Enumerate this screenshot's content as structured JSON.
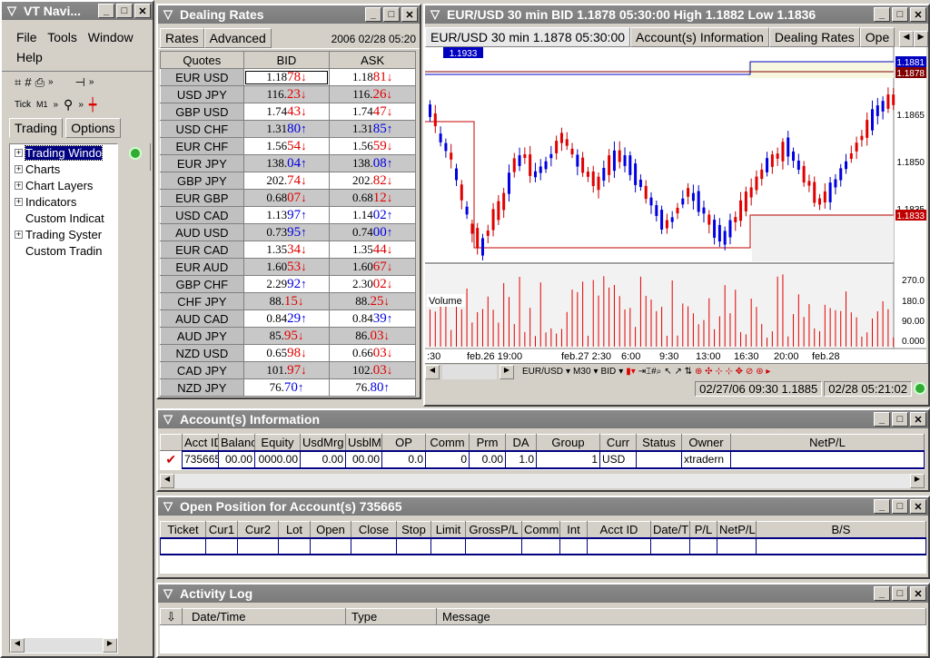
{
  "navigator": {
    "title": "VT Navi...",
    "menu": [
      "File",
      "Tools",
      "Window",
      "Help"
    ],
    "tick_label": "Tick",
    "timeframe": "M1",
    "tabs": [
      "Trading",
      "Options"
    ],
    "tree": [
      {
        "label": "Trading Windo",
        "expand": "+",
        "selected": true
      },
      {
        "label": "Charts",
        "expand": "+"
      },
      {
        "label": "Chart Layers",
        "expand": "+"
      },
      {
        "label": "Indicators",
        "expand": "+"
      },
      {
        "label": "Custom Indicat",
        "expand": ""
      },
      {
        "label": "Trading Syster",
        "expand": "+"
      },
      {
        "label": "Custom Tradin",
        "expand": ""
      }
    ]
  },
  "dealing": {
    "title": "Dealing Rates",
    "tabs": [
      "Rates",
      "Advanced"
    ],
    "datetime": "2006 02/28 05:20",
    "col_quotes": "Quotes",
    "col_bid": "BID",
    "col_ask": "ASK",
    "rows": [
      {
        "pair": "EUR USD",
        "bid_a": "1.18",
        "bid_b": "78",
        "bid_dir": "dn",
        "ask_a": "1.18",
        "ask_b": "81",
        "ask_dir": "dn"
      },
      {
        "pair": "USD JPY",
        "bid_a": "116.",
        "bid_b": "23",
        "bid_dir": "dn",
        "ask_a": "116.",
        "ask_b": "26",
        "ask_dir": "dn"
      },
      {
        "pair": "GBP USD",
        "bid_a": "1.74",
        "bid_b": "43",
        "bid_dir": "dn",
        "ask_a": "1.74",
        "ask_b": "47",
        "ask_dir": "dn"
      },
      {
        "pair": "USD CHF",
        "bid_a": "1.31",
        "bid_b": "80",
        "bid_dir": "up",
        "ask_a": "1.31",
        "ask_b": "85",
        "ask_dir": "up"
      },
      {
        "pair": "EUR CHF",
        "bid_a": "1.56",
        "bid_b": "54",
        "bid_dir": "dn",
        "ask_a": "1.56",
        "ask_b": "59",
        "ask_dir": "dn"
      },
      {
        "pair": "EUR JPY",
        "bid_a": "138.",
        "bid_b": "04",
        "bid_dir": "up",
        "ask_a": "138.",
        "ask_b": "08",
        "ask_dir": "up"
      },
      {
        "pair": "GBP JPY",
        "bid_a": "202.",
        "bid_b": "74",
        "bid_dir": "dn",
        "ask_a": "202.",
        "ask_b": "82",
        "ask_dir": "dn"
      },
      {
        "pair": "EUR GBP",
        "bid_a": "0.68",
        "bid_b": "07",
        "bid_dir": "dn",
        "ask_a": "0.68",
        "ask_b": "12",
        "ask_dir": "dn"
      },
      {
        "pair": "USD CAD",
        "bid_a": "1.13",
        "bid_b": "97",
        "bid_dir": "up",
        "ask_a": "1.14",
        "ask_b": "02",
        "ask_dir": "up"
      },
      {
        "pair": "AUD USD",
        "bid_a": "0.73",
        "bid_b": "95",
        "bid_dir": "up",
        "ask_a": "0.74",
        "ask_b": "00",
        "ask_dir": "up"
      },
      {
        "pair": "EUR CAD",
        "bid_a": "1.35",
        "bid_b": "34",
        "bid_dir": "dn",
        "ask_a": "1.35",
        "ask_b": "44",
        "ask_dir": "dn"
      },
      {
        "pair": "EUR AUD",
        "bid_a": "1.60",
        "bid_b": "53",
        "bid_dir": "dn",
        "ask_a": "1.60",
        "ask_b": "67",
        "ask_dir": "dn"
      },
      {
        "pair": "GBP CHF",
        "bid_a": "2.29",
        "bid_b": "92",
        "bid_dir": "up",
        "ask_a": "2.30",
        "ask_b": "02",
        "ask_dir": "dn"
      },
      {
        "pair": "CHF JPY",
        "bid_a": "88.",
        "bid_b": "15",
        "bid_dir": "dn",
        "ask_a": "88.",
        "ask_b": "25",
        "ask_dir": "dn"
      },
      {
        "pair": "AUD CAD",
        "bid_a": "0.84",
        "bid_b": "29",
        "bid_dir": "up",
        "ask_a": "0.84",
        "ask_b": "39",
        "ask_dir": "up"
      },
      {
        "pair": "AUD JPY",
        "bid_a": "85.",
        "bid_b": "95",
        "bid_dir": "dn",
        "ask_a": "86.",
        "ask_b": "03",
        "ask_dir": "dn"
      },
      {
        "pair": "NZD USD",
        "bid_a": "0.65",
        "bid_b": "98",
        "bid_dir": "dn",
        "ask_a": "0.66",
        "ask_b": "03",
        "ask_dir": "dn"
      },
      {
        "pair": "CAD JPY",
        "bid_a": "101.",
        "bid_b": "97",
        "bid_dir": "dn",
        "ask_a": "102.",
        "ask_b": "03",
        "ask_dir": "dn"
      },
      {
        "pair": "NZD JPY",
        "bid_a": "76.",
        "bid_b": "70",
        "bid_dir": "up",
        "ask_a": "76.",
        "ask_b": "80",
        "ask_dir": "up"
      }
    ]
  },
  "chartwin": {
    "title": "EUR/USD 30 min BID 1.1878 05:30:00 High 1.1882 Low 1.1836",
    "tabs": [
      "EUR/USD 30 min 1.1878 05:30:00",
      "Account(s) Information",
      "Dealing Rates",
      "Ope"
    ],
    "marker_label": "1.1933",
    "price_ticks": [
      "1.1865",
      "1.1850",
      "1.1835"
    ],
    "price_labels": {
      "top1": "1.1881",
      "top2": "1.1878",
      "low": "1.1833"
    },
    "volume_label": "Volume",
    "volume_ticks": [
      "270.0",
      "180.0",
      "90.00",
      "0.000"
    ],
    "time_ticks": [
      ":30",
      "feb.26 19:00",
      "feb.27 2:30",
      "6:00",
      "9:30",
      "13:00",
      "16:30",
      "20:00",
      "feb.28"
    ],
    "toolbar": {
      "symbol": "EUR/USD",
      "period": "M30",
      "side": "BID"
    },
    "status_left": "02/27/06 09:30  1.1885",
    "status_right": "02/28 05:21:02"
  },
  "account": {
    "title": "Account(s) Information",
    "columns": [
      "Acct ID",
      "Balanc",
      "Equity",
      "UsdMrg",
      "UsblM",
      "OP",
      "Comm",
      "Prm",
      "DA",
      "Group",
      "Curr",
      "Status",
      "Owner",
      "NetP/L"
    ],
    "row": [
      "735665",
      "00.00",
      "0000.00",
      "0.00",
      "00.00",
      "0.0",
      "0",
      "0.00",
      "1.0",
      "1",
      "USD",
      "",
      "xtradern",
      ""
    ]
  },
  "positions": {
    "title": "Open Position for Account(s)  735665",
    "columns": [
      "Ticket",
      "Cur1",
      "Cur2",
      "Lot",
      "Open",
      "Close",
      "Stop",
      "Limit",
      "GrossP/L",
      "Comm",
      "Int",
      "Acct ID",
      "Date/T",
      "P/L",
      "NetP/L",
      "B/S"
    ]
  },
  "activity": {
    "title": "Activity Log",
    "columns": [
      "Date/Time",
      "Type",
      "Message"
    ]
  },
  "colors": {
    "up": "#0000e0",
    "down": "#e00000",
    "titlebar": "#808080"
  }
}
